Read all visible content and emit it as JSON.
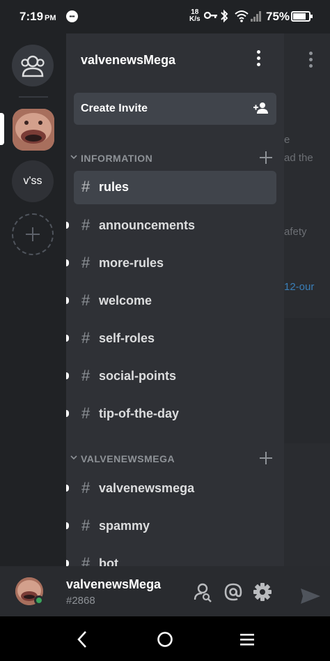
{
  "status_bar": {
    "time": "7:19",
    "ampm": "PM",
    "network_speed_value": "18",
    "network_speed_unit": "K/s",
    "battery": "75%",
    "icons": [
      "chat-notification-icon",
      "vpn-key-icon",
      "bluetooth-icon",
      "wifi-icon",
      "signal-icon",
      "battery-icon"
    ]
  },
  "server_rail": {
    "home_icon": "direct-messages-icon",
    "servers": [
      {
        "name": "valvenewsMega",
        "icon": "server-avatar",
        "selected": true
      },
      {
        "name": "v'ss",
        "label": "v'ss"
      }
    ],
    "add_server_icon": "plus-icon"
  },
  "guild": {
    "name": "valvenewsMega",
    "menu_icon": "kebab-menu-icon",
    "create_invite_label": "Create Invite",
    "create_invite_icon": "add-person-icon"
  },
  "categories": [
    {
      "name": "INFORMATION",
      "channels": [
        {
          "name": "rules",
          "active": true,
          "unread": false
        },
        {
          "name": "announcements",
          "active": false,
          "unread": true
        },
        {
          "name": "more-rules",
          "active": false,
          "unread": true
        },
        {
          "name": "welcome",
          "active": false,
          "unread": true
        },
        {
          "name": "self-roles",
          "active": false,
          "unread": true
        },
        {
          "name": "social-points",
          "active": false,
          "unread": true
        },
        {
          "name": "tip-of-the-day",
          "active": false,
          "unread": true
        }
      ]
    },
    {
      "name": "VALVENEWSMEGA",
      "channels": [
        {
          "name": "valvenewsmega",
          "active": false,
          "unread": true
        },
        {
          "name": "spammy",
          "active": false,
          "unread": true
        },
        {
          "name": "bot",
          "active": false,
          "unread": true
        }
      ]
    }
  ],
  "hash_symbol": "#",
  "chat_peek": {
    "lines": [
      "e",
      "ad the",
      "afety",
      "12-our"
    ]
  },
  "user": {
    "name": "valvenewsMega",
    "tag": "#2868",
    "status": "online",
    "status_color": "#3ba55d",
    "icons": [
      "search-members-icon",
      "mentions-icon",
      "settings-icon"
    ]
  },
  "colors": {
    "rail_bg": "#202225",
    "channels_bg": "#2f3136",
    "active_channel_bg": "#40444b",
    "userbar_bg": "#292b2f",
    "link": "#3a7fb8"
  }
}
